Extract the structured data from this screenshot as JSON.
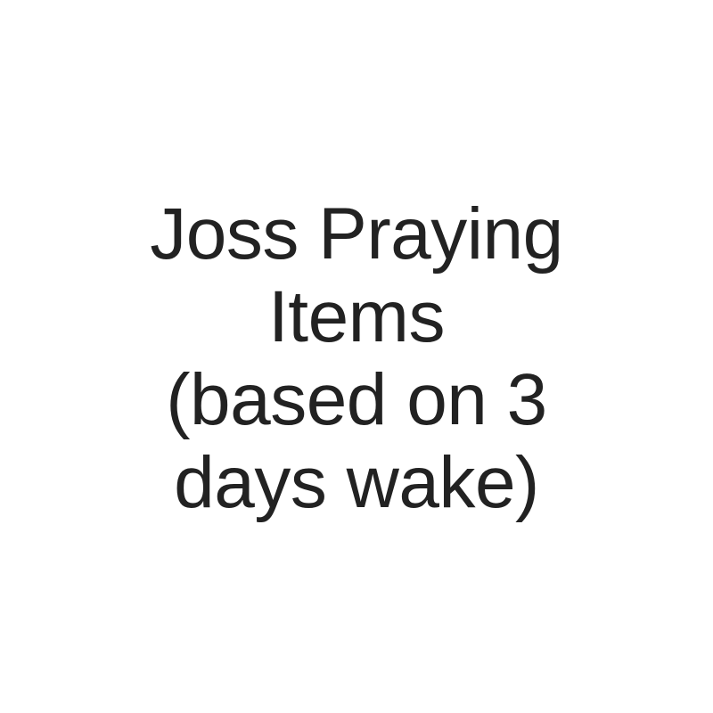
{
  "title": {
    "lines": [
      "Joss Praying",
      "Items",
      "(based on 3",
      "days wake)"
    ]
  },
  "colors": {
    "background": "#ffffff",
    "text": "#222222"
  }
}
